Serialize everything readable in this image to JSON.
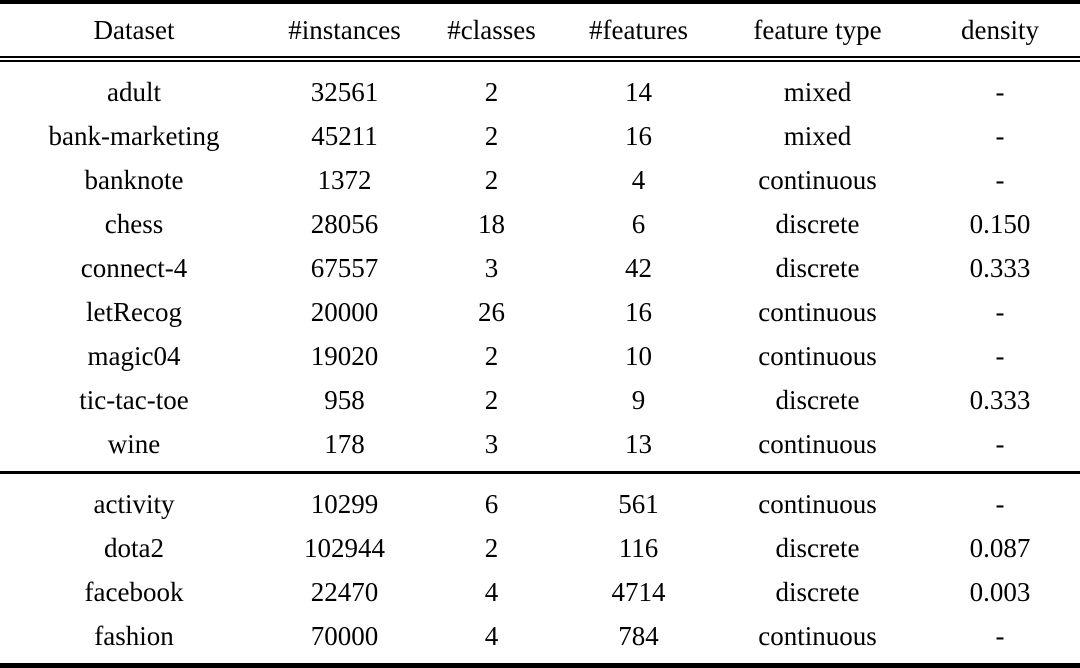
{
  "table": {
    "caption": "",
    "columns": [
      {
        "key": "dataset",
        "label": "Dataset",
        "align": "center"
      },
      {
        "key": "instances",
        "label": "#instances",
        "align": "center"
      },
      {
        "key": "classes",
        "label": "#classes",
        "align": "center"
      },
      {
        "key": "features",
        "label": "#features",
        "align": "center"
      },
      {
        "key": "ftype",
        "label": "feature type",
        "align": "center"
      },
      {
        "key": "density",
        "label": "density",
        "align": "center"
      }
    ],
    "groups": [
      {
        "name": "group-1",
        "rows": [
          {
            "dataset": "adult",
            "instances": "32561",
            "classes": "2",
            "features": "14",
            "ftype": "mixed",
            "density": "-"
          },
          {
            "dataset": "bank-marketing",
            "instances": "45211",
            "classes": "2",
            "features": "16",
            "ftype": "mixed",
            "density": "-"
          },
          {
            "dataset": "banknote",
            "instances": "1372",
            "classes": "2",
            "features": "4",
            "ftype": "continuous",
            "density": "-"
          },
          {
            "dataset": "chess",
            "instances": "28056",
            "classes": "18",
            "features": "6",
            "ftype": "discrete",
            "density": "0.150"
          },
          {
            "dataset": "connect-4",
            "instances": "67557",
            "classes": "3",
            "features": "42",
            "ftype": "discrete",
            "density": "0.333"
          },
          {
            "dataset": "letRecog",
            "instances": "20000",
            "classes": "26",
            "features": "16",
            "ftype": "continuous",
            "density": "-"
          },
          {
            "dataset": "magic04",
            "instances": "19020",
            "classes": "2",
            "features": "10",
            "ftype": "continuous",
            "density": "-"
          },
          {
            "dataset": "tic-tac-toe",
            "instances": "958",
            "classes": "2",
            "features": "9",
            "ftype": "discrete",
            "density": "0.333"
          },
          {
            "dataset": "wine",
            "instances": "178",
            "classes": "3",
            "features": "13",
            "ftype": "continuous",
            "density": "-"
          }
        ]
      },
      {
        "name": "group-2",
        "rows": [
          {
            "dataset": "activity",
            "instances": "10299",
            "classes": "6",
            "features": "561",
            "ftype": "continuous",
            "density": "-"
          },
          {
            "dataset": "dota2",
            "instances": "102944",
            "classes": "2",
            "features": "116",
            "ftype": "discrete",
            "density": "0.087"
          },
          {
            "dataset": "facebook",
            "instances": "22470",
            "classes": "4",
            "features": "4714",
            "ftype": "discrete",
            "density": "0.003"
          },
          {
            "dataset": "fashion",
            "instances": "70000",
            "classes": "4",
            "features": "784",
            "ftype": "continuous",
            "density": "-"
          }
        ]
      }
    ]
  },
  "colors": {
    "text": "#000000",
    "background": "#ffffff",
    "rule": "#000000"
  }
}
